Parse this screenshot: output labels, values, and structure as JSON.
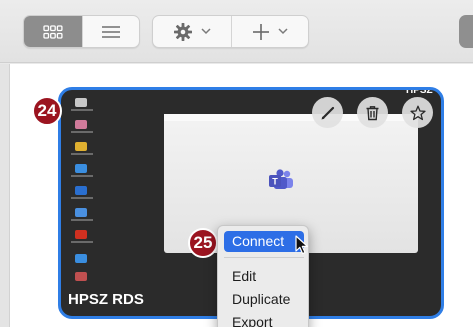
{
  "card": {
    "title": "HPSZ RDS",
    "tag": "HPSZ"
  },
  "callouts": {
    "card_step": "24",
    "connect_step": "25"
  },
  "menu": {
    "connect": "Connect",
    "edit": "Edit",
    "duplicate": "Duplicate",
    "export": "Export"
  },
  "icons": {
    "view": [
      "grid-icon",
      "list-icon"
    ],
    "actions": [
      "gear-icon",
      "chevron-down-icon",
      "plus-icon",
      "chevron-down-icon"
    ],
    "card_buttons": [
      "pencil-icon",
      "trash-icon",
      "star-icon"
    ]
  },
  "colors": {
    "accent": "#2f7ee6",
    "menu_highlight": "#2d6ee6",
    "callout": "#9b1420",
    "card_bg": "#2b2b2b"
  }
}
